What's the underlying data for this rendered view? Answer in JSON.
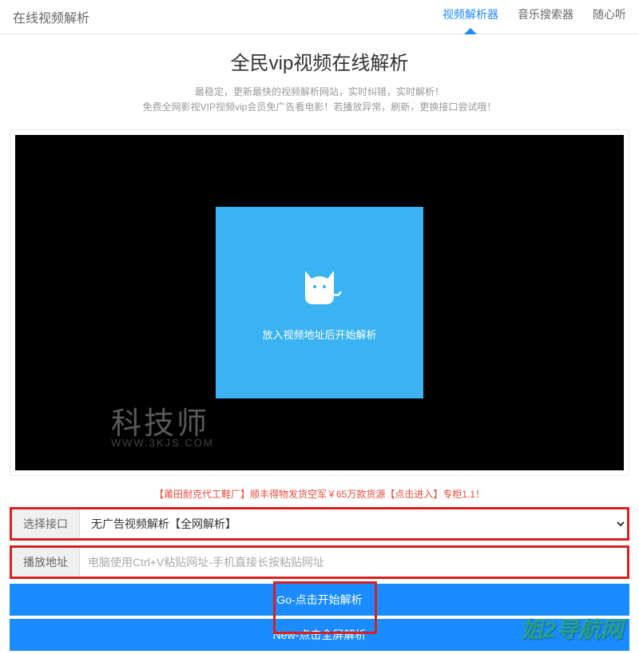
{
  "header": {
    "brand": "在线视频解析",
    "nav": [
      {
        "label": "视频解析器",
        "active": true
      },
      {
        "label": "音乐搜索器",
        "active": false
      },
      {
        "label": "随心听",
        "active": false
      }
    ]
  },
  "title": {
    "main": "全民vip视频在线解析",
    "sub1": "最稳定，更新最快的视频解析网站，实时纠错，实时解析！",
    "sub2": "免费全网影视VIP视频vip会员免广告看电影！若播放异常，刷新，更换接口尝试哦！"
  },
  "player": {
    "hint": "放入视频地址后开始解析",
    "watermark": "科技师",
    "watermark_url": "WWW.3KJS.COM"
  },
  "ad": "【莆田耐克代工鞋厂】顺丰得物发货空军￥65万款货源【点击进入】专柜1.1！",
  "form": {
    "select_label": "选择接口",
    "select_value": "无广告视频解析【全网解析】",
    "input_label": "播放地址",
    "input_placeholder": "电脑使用Ctrl+V粘贴网址-手机直接长按粘贴网址"
  },
  "buttons": {
    "go": "Go-点击开始解析",
    "new": "New-点击全屏解析"
  },
  "bottom_watermark": "姐2导航网"
}
